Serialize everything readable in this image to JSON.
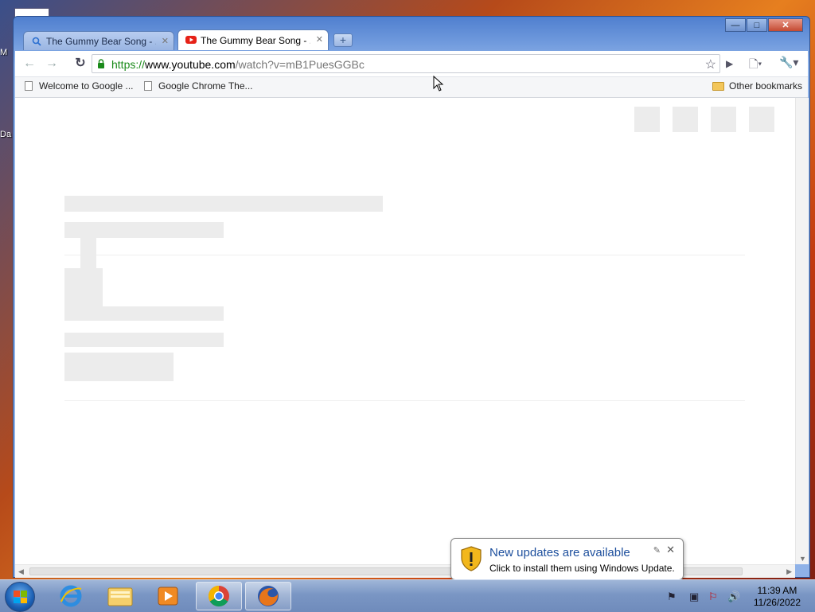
{
  "desktop": {
    "icon_labels": [
      "M",
      "Da"
    ]
  },
  "window": {
    "controls": {
      "minimize": "—",
      "maximize": "□",
      "close": "✕"
    },
    "tabs": [
      {
        "label": "The Gummy Bear Song - ...",
        "icon": "search-icon",
        "active": false
      },
      {
        "label": "The Gummy Bear Song - ...",
        "icon": "youtube-icon",
        "active": true
      }
    ],
    "new_tab_label": "+"
  },
  "toolbar": {
    "back": "←",
    "forward": "→",
    "reload": "↻",
    "url_https": "https://",
    "url_host": "www.youtube.com",
    "url_path": "/watch?v=mB1PuesGGBc",
    "star": "☆",
    "page_menu": "▶",
    "doc_menu": "🗋▾",
    "wrench_menu": "🔧▾"
  },
  "bookmarks": {
    "items": [
      "Welcome to Google ...",
      "Google Chrome The..."
    ],
    "other": "Other bookmarks"
  },
  "notification": {
    "title": "New updates are available",
    "message": "Click to install them using Windows Update.",
    "options_glyph": "✎",
    "close_glyph": "✕"
  },
  "taskbar": {
    "time": "11:39 AM",
    "date": "11/26/2022",
    "apps": [
      "internet-explorer",
      "windows-explorer",
      "media-player",
      "google-chrome",
      "firefox"
    ]
  },
  "colors": {
    "url_secure": "#1a8a1a",
    "notification_title": "#1d4f9d",
    "placeholder": "#ececec"
  }
}
